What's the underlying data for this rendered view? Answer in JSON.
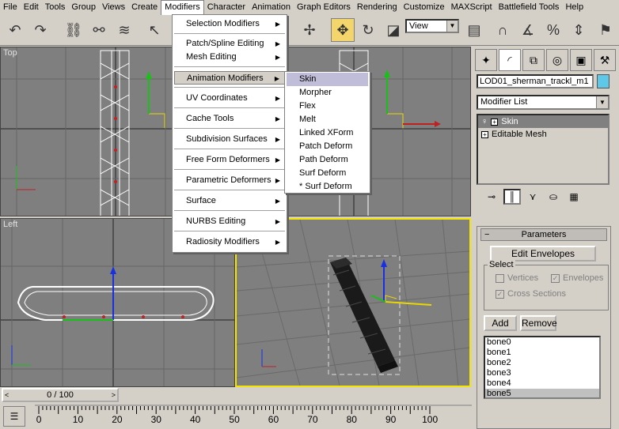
{
  "menubar": {
    "items": [
      "File",
      "Edit",
      "Tools",
      "Group",
      "Views",
      "Create",
      "Modifiers",
      "Character",
      "Animation",
      "Graph Editors",
      "Rendering",
      "Customize",
      "MAXScript",
      "Battlefield Tools",
      "Help"
    ],
    "active": "Modifiers"
  },
  "toolbar": {
    "view_select": "View"
  },
  "viewports": {
    "top_label": "Top",
    "left_label": "Left"
  },
  "modifiers_menu": {
    "items": [
      "Selection Modifiers",
      "Patch/Spline Editing",
      "Mesh Editing",
      "Animation Modifiers",
      "UV Coordinates",
      "Cache Tools",
      "Subdivision Surfaces",
      "Free Form Deformers",
      "Parametric Deformers",
      "Surface",
      "NURBS Editing",
      "Radiosity Modifiers"
    ],
    "highlighted": "Animation Modifiers"
  },
  "animation_submenu": {
    "items": [
      "Skin",
      "Morpher",
      "Flex",
      "Melt",
      "Linked XForm",
      "Patch Deform",
      "Path Deform",
      "Surf Deform",
      "* Surf Deform"
    ],
    "highlighted": "Skin"
  },
  "command_panel": {
    "object_name": "LOD01_sherman_trackl_m1",
    "object_color": "#5fc8e8",
    "modifier_list": "Modifier List",
    "stack": [
      {
        "label": "Skin",
        "selected": true,
        "box": "+"
      },
      {
        "label": "Editable Mesh",
        "selected": false,
        "box": "+"
      }
    ],
    "rollout_title": "Parameters",
    "edit_envelopes": "Edit Envelopes",
    "select_group": "Select",
    "vertices": "Vertices",
    "envelopes": "Envelopes",
    "cross_sections": "Cross Sections",
    "add": "Add",
    "remove": "Remove",
    "bones": [
      "bone0",
      "bone1",
      "bone2",
      "bone3",
      "bone4",
      "bone5"
    ],
    "selected_bone": "bone5"
  },
  "timeline": {
    "slider_text": "0 / 100",
    "ticks": [
      "0",
      "10",
      "20",
      "30",
      "40",
      "50",
      "60",
      "70",
      "80",
      "90",
      "100"
    ]
  },
  "colors": {
    "viewport_bg": "#7f7f7f",
    "active_viewport_border": "#f5e600",
    "menu_highlight": "#c0bdd8"
  }
}
